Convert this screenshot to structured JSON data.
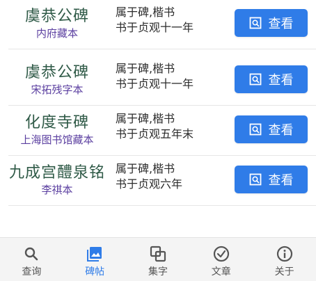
{
  "items": [
    {
      "title": "虞恭公碑",
      "subtitle": "内府藏本",
      "line1": "属于碑,楷书",
      "line2": "书于贞观十一年",
      "button": "查看"
    },
    {
      "title": "虞恭公碑",
      "subtitle": "宋拓残字本",
      "line1": "属于碑,楷书",
      "line2": "书于贞观十一年",
      "button": "查看"
    },
    {
      "title": "化度寺碑",
      "subtitle": "上海图书馆藏本",
      "line1": "属于碑,楷书",
      "line2": "书于贞观五年末",
      "button": "查看"
    },
    {
      "title": "九成宫醴泉铭",
      "subtitle": "李祺本",
      "line1": "属于碑,楷书",
      "line2": "书于贞观六年",
      "button": "查看"
    }
  ],
  "tabs": [
    {
      "label": "查询",
      "icon": "search-icon",
      "active": false
    },
    {
      "label": "碑帖",
      "icon": "image-icon",
      "active": true
    },
    {
      "label": "集字",
      "icon": "layers-icon",
      "active": false
    },
    {
      "label": "文章",
      "icon": "check-circle-icon",
      "active": false
    },
    {
      "label": "关于",
      "icon": "info-icon",
      "active": false
    }
  ],
  "colors": {
    "accent": "#2f7ce8",
    "title": "#2f5a47",
    "subtitle": "#5b3fa0"
  }
}
